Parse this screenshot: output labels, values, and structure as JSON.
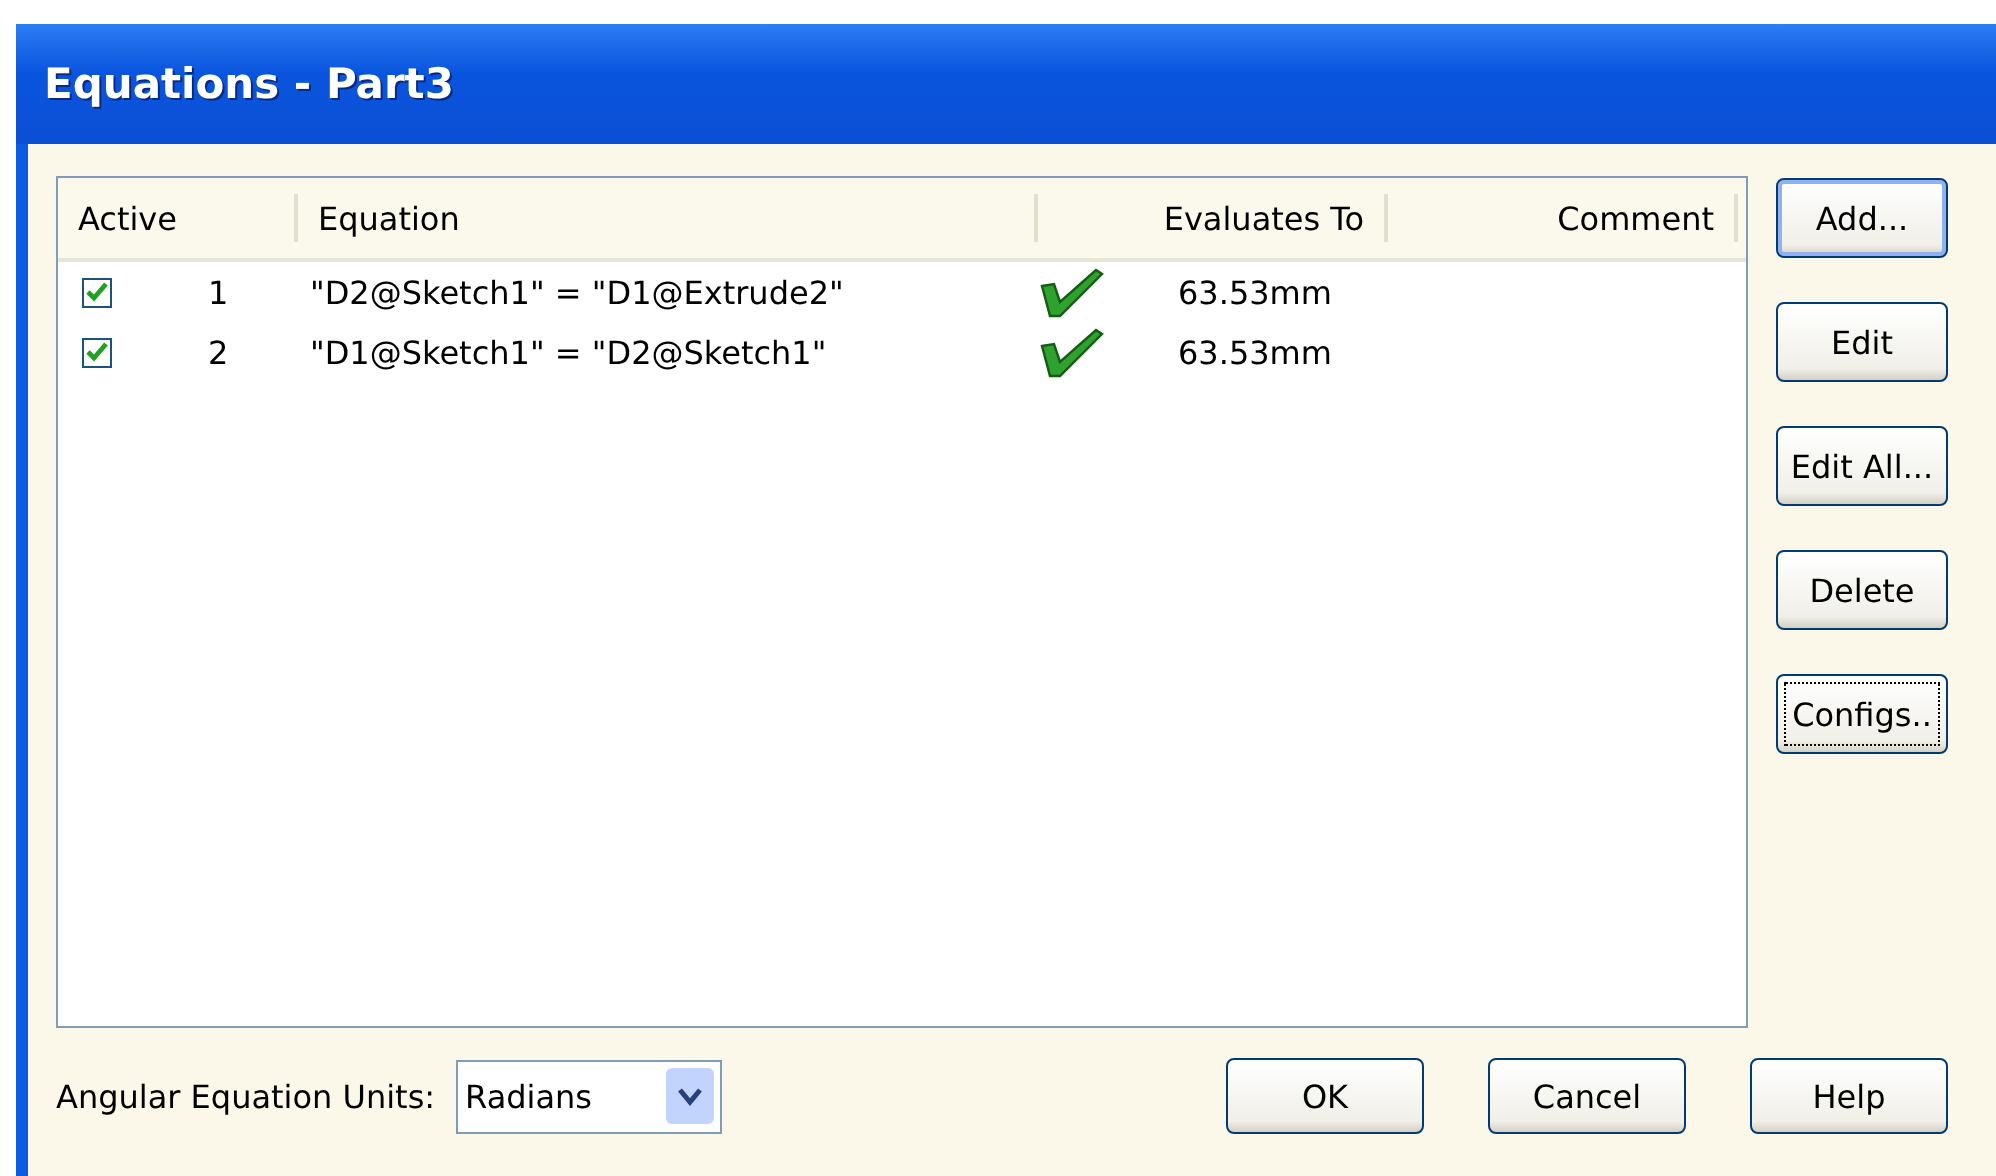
{
  "window": {
    "title": "Equations - Part3"
  },
  "table": {
    "columns": [
      {
        "label": "Active"
      },
      {
        "label": "Equation"
      },
      {
        "label": "Evaluates To"
      },
      {
        "label": "Comment"
      }
    ],
    "rows": [
      {
        "checked": true,
        "number": "1",
        "equation": "\"D2@Sketch1\" = \"D1@Extrude2\"",
        "valid": true,
        "value": "63.53mm"
      },
      {
        "checked": true,
        "number": "2",
        "equation": "\"D1@Sketch1\" = \"D2@Sketch1\"",
        "valid": true,
        "value": "63.53mm"
      }
    ]
  },
  "side_buttons": [
    {
      "label": "Add...",
      "default": true,
      "focused": false
    },
    {
      "label": "Edit",
      "default": false,
      "focused": false
    },
    {
      "label": "Edit All...",
      "default": false,
      "focused": false
    },
    {
      "label": "Delete",
      "default": false,
      "focused": false
    },
    {
      "label": "Configs..",
      "default": false,
      "focused": true
    }
  ],
  "units": {
    "label": "Angular Equation Units:",
    "value": "Radians"
  },
  "bottom_buttons": [
    {
      "label": "OK"
    },
    {
      "label": "Cancel"
    },
    {
      "label": "Help"
    }
  ]
}
